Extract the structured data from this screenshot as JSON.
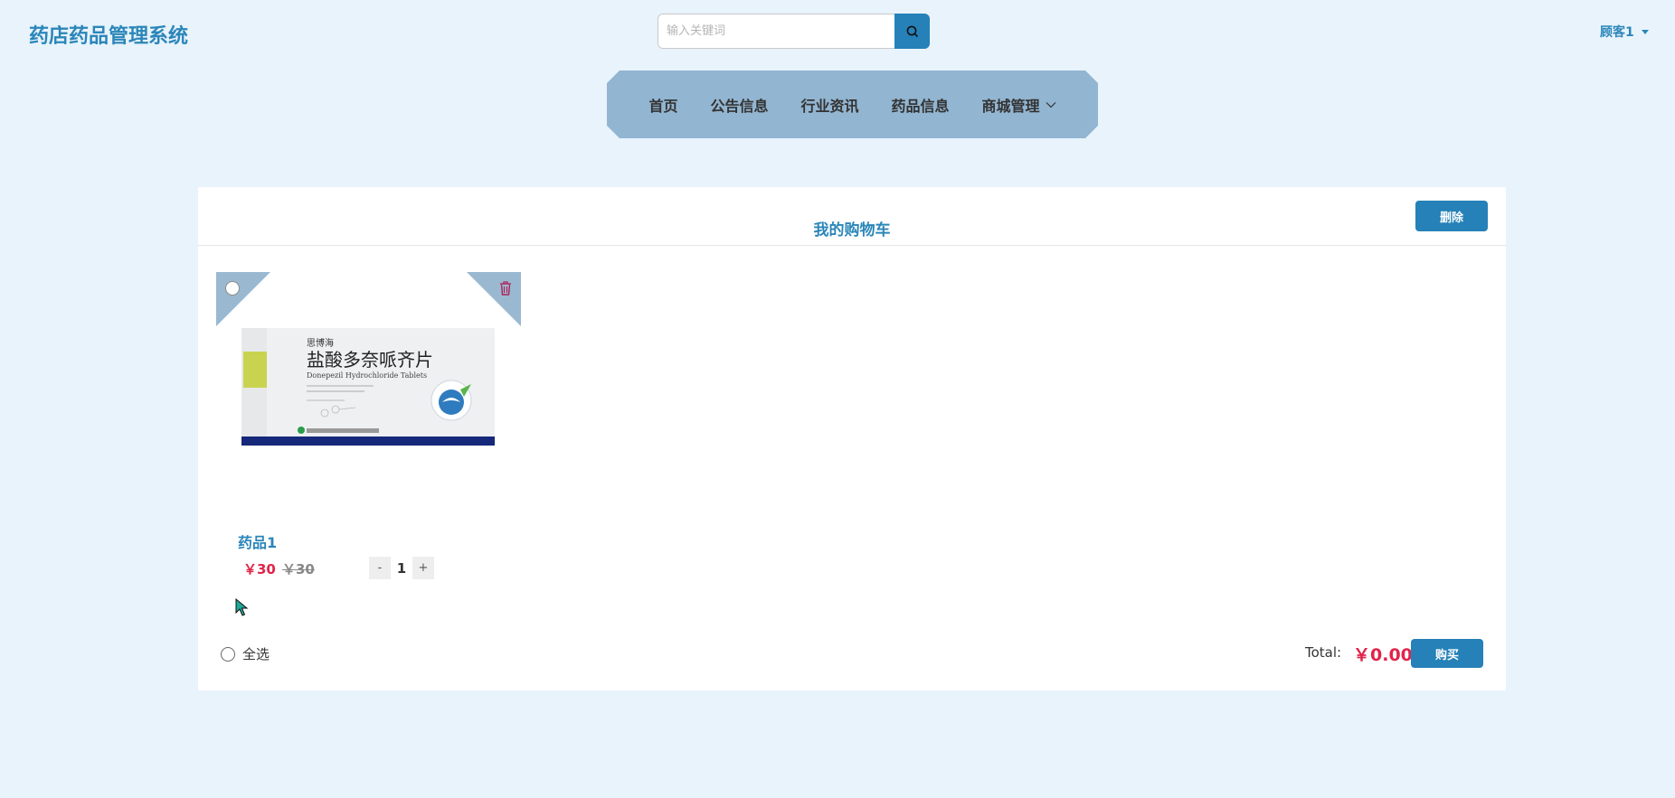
{
  "header": {
    "logo": "药店药品管理系统",
    "search_placeholder": "输入关键词",
    "user_label": "顾客1"
  },
  "nav": {
    "items": [
      "首页",
      "公告信息",
      "行业资讯",
      "药品信息",
      "商城管理"
    ]
  },
  "cart": {
    "title": "我的购物车",
    "delete_label": "删除",
    "item": {
      "name": "药品1",
      "price": "￥30",
      "old_price": "￥30",
      "quantity": "1",
      "minus_label": "-",
      "plus_label": "+",
      "image": {
        "brand": "思博海",
        "product_name_cn": "盐酸多奈哌齐片",
        "product_name_en": "Donepezil Hydrochloride Tablets"
      }
    },
    "select_all_label": "全选",
    "total_label": "Total:",
    "total_value": "￥0.00",
    "buy_label": "购买"
  },
  "colors": {
    "accent": "#2581b8",
    "price": "#e2234a",
    "nav_bg": "#92b5d1",
    "page_bg": "#e8f3fc"
  }
}
